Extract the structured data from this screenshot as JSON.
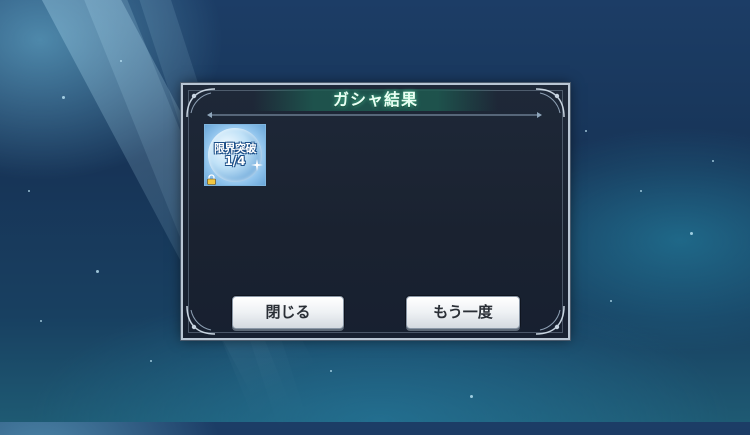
{
  "dialog": {
    "title": "ガシャ結果",
    "items": [
      {
        "line1": "限界突破",
        "line2": "1/4",
        "locked": true
      }
    ],
    "buttons": {
      "close_label": "閉じる",
      "again_label": "もう一度"
    }
  },
  "colors": {
    "title_glow": "#5adcaa",
    "panel_bg": "#1c2535",
    "frame": "#b9c6d4",
    "button_face": "#eef1f4"
  },
  "icons": [
    "lock-icon",
    "sparkle-icon"
  ]
}
